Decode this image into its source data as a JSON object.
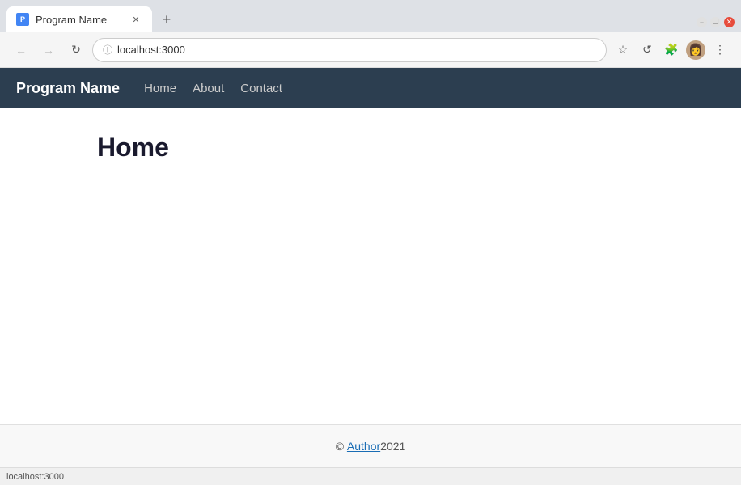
{
  "browser": {
    "tab": {
      "favicon_label": "P",
      "title": "Program Name",
      "close_icon": "✕"
    },
    "new_tab_icon": "+",
    "window_controls": {
      "minimize_icon": "−",
      "restore_icon": "❐",
      "close_icon": "✕"
    },
    "nav": {
      "back_icon": "←",
      "forward_icon": "→",
      "reload_icon": "↻",
      "address": "localhost:3000",
      "secure_icon": "ⓘ",
      "bookmark_icon": "☆",
      "account_icon": "⊙",
      "extensions_icon": "⚙",
      "menu_icon": "⋮"
    },
    "status_bar_text": "localhost:3000"
  },
  "app": {
    "brand": "Program Name",
    "nav_links": [
      {
        "label": "Home",
        "href": "#"
      },
      {
        "label": "About",
        "href": "#"
      },
      {
        "label": "Contact",
        "href": "#"
      }
    ],
    "page_heading": "Home",
    "footer": {
      "copyright": "©",
      "link_text": "Author",
      "year": " 2021"
    }
  }
}
